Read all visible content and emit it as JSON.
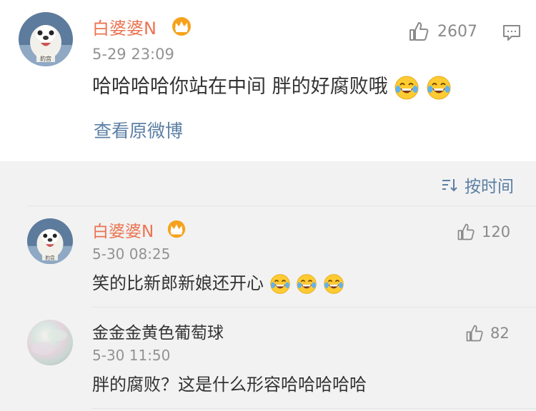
{
  "main_comment": {
    "username": "白婆婆N",
    "time": "5-29 23:09",
    "likes": "2607",
    "text": "哈哈哈哈你站在中间 胖的好腐败哦",
    "emoji": [
      "laugh-cry-icon",
      "laugh-cry-icon"
    ],
    "view_original": "查看原微博"
  },
  "sort": {
    "label": "按时间"
  },
  "replies": [
    {
      "username": "白婆婆N",
      "time": "5-30 08:25",
      "likes": "120",
      "text": "笑的比新郎新娘还开心",
      "emoji": [
        "laugh-cry-icon",
        "laugh-cry-icon",
        "laugh-cry-icon"
      ]
    },
    {
      "username": "金金金黄色葡萄球",
      "time": "5-30 11:50",
      "likes": "82",
      "text": "胖的腐败？这是什么形容哈哈哈哈哈"
    }
  ],
  "colors": {
    "username": "#eb7350",
    "link": "#5b7fa4",
    "time": "#939393",
    "background": "#f2f2f2"
  }
}
